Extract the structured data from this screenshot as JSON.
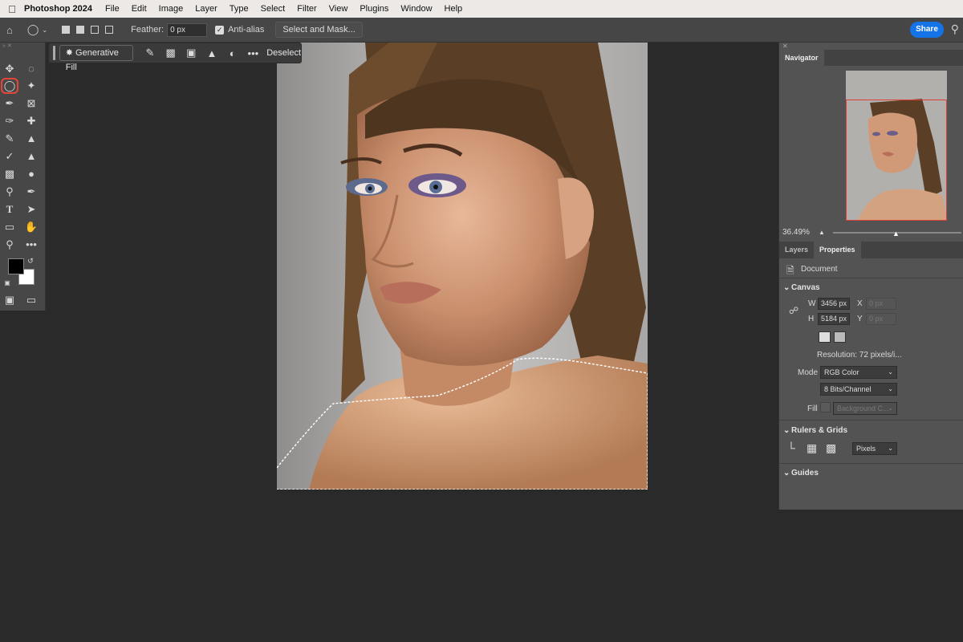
{
  "menubar": {
    "app_name": "Photoshop 2024",
    "items": [
      "File",
      "Edit",
      "Image",
      "Layer",
      "Type",
      "Select",
      "Filter",
      "View",
      "Plugins",
      "Window",
      "Help"
    ]
  },
  "options": {
    "feather_label": "Feather:",
    "feather_value": "0 px",
    "anti_alias_label": "Anti-alias",
    "select_and_mask_label": "Select and Mask...",
    "share_label": "Share"
  },
  "context_bar": {
    "generative_fill_label": "Generative Fill",
    "deselect_label": "Deselect",
    "more_label": "•••"
  },
  "panels": {
    "navigator_tab": "Navigator",
    "zoom_value": "36.49%",
    "layers_tab": "Layers",
    "properties_tab": "Properties",
    "document_label": "Document",
    "canvas_section": "Canvas",
    "w_label": "W",
    "w_value": "3456 px",
    "h_label": "H",
    "h_value": "5184 px",
    "x_label": "X",
    "x_value": "0 px",
    "y_label": "Y",
    "y_value": "0 px",
    "resolution_text": "Resolution: 72 pixels/i...",
    "mode_label": "Mode",
    "mode_value": "RGB Color",
    "bits_value": "8 Bits/Channel",
    "fill_label": "Fill",
    "fill_value": "Background C...",
    "rulers_section": "Rulers & Grids",
    "units_value": "Pixels",
    "guides_section": "Guides"
  },
  "colors": {
    "active_tool_highlight": "#e6453a",
    "share_button": "#1473e6",
    "navigator_frame": "#e0403a"
  }
}
